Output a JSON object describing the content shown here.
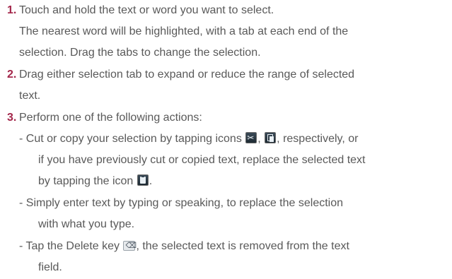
{
  "step1": {
    "number": "1.",
    "line1": "Touch and hold the text or word you want to select.",
    "line2": "The nearest word will be highlighted, with a tab at each end of the",
    "line3": "selection. Drag the tabs to change the selection."
  },
  "step2": {
    "number": "2.",
    "line1": "Drag either selection tab to expand or reduce the range of selected",
    "line2": "text."
  },
  "step3": {
    "number": "3.",
    "line1": "Perform one of the following actions:",
    "cut_copy": {
      "part1": "- Cut or copy your selection by tapping icons ",
      "sep": ", ",
      "part2": ", respectively, or",
      "line2": "if you have previously cut or copied text, replace the selected text",
      "line3_prefix": "by tapping the icon ",
      "line3_suffix": "."
    },
    "enter": {
      "line1": "- Simply enter text by typing or speaking, to replace the selection",
      "line2": "with what you type."
    },
    "delete": {
      "line1_prefix": "- Tap the Delete key ",
      "line1_suffix": ", the selected text is removed from the text",
      "line2": "field."
    }
  },
  "icons": {
    "cut": "cut-icon",
    "copy": "copy-icon",
    "paste": "paste-icon",
    "delete": "delete-key-icon"
  },
  "colors": {
    "step_number": "#a3264a",
    "body_text": "#595959"
  }
}
